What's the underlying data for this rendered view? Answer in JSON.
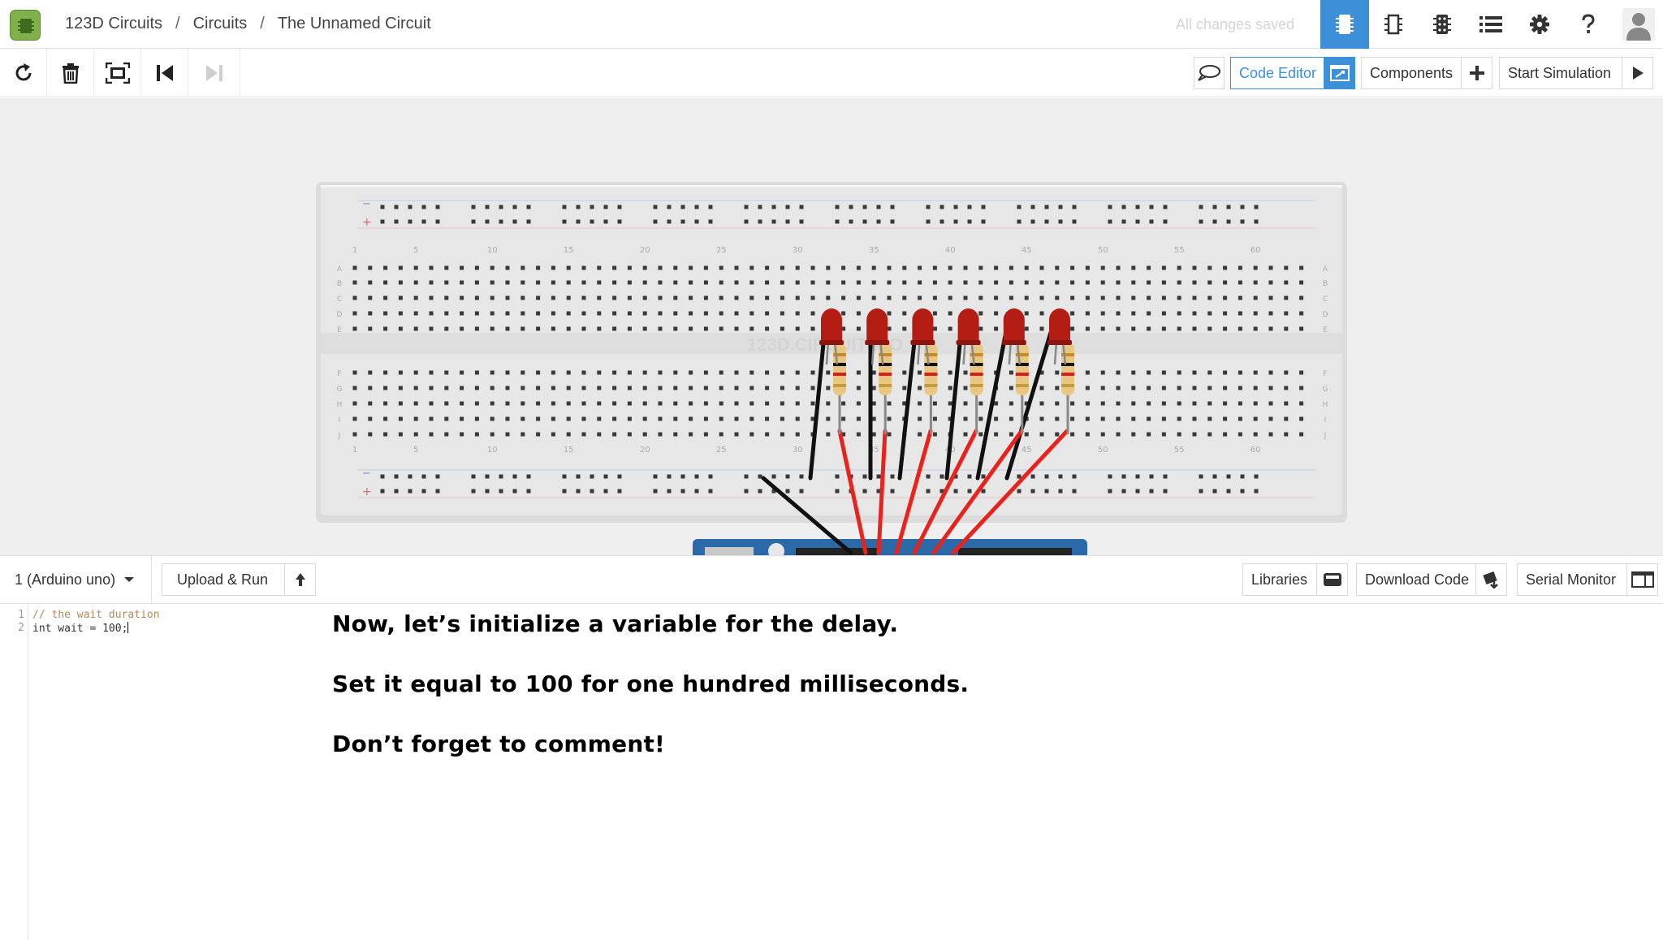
{
  "app": {
    "breadcrumb": [
      "123D Circuits",
      "Circuits",
      "The Unnamed Circuit"
    ],
    "save_status": "All changes saved"
  },
  "topbar_icons": [
    "breadboard-view-icon",
    "schematic-view-icon",
    "pcb-view-icon",
    "component-list-icon",
    "settings-icon",
    "help-icon",
    "user-avatar-icon"
  ],
  "toolbar": {
    "tools": [
      "rotate-icon",
      "delete-icon",
      "fit-to-screen-icon",
      "step-back-icon",
      "step-forward-icon"
    ],
    "code_editor_label": "Code Editor",
    "components_label": "Components",
    "start_simulation_label": "Start Simulation"
  },
  "breadboard": {
    "watermark": "123D.CIRCUITS.IO",
    "column_numbers_top": [
      "1",
      "5",
      "10",
      "15",
      "20",
      "25",
      "30",
      "35",
      "40",
      "45",
      "50",
      "55",
      "60"
    ],
    "column_numbers_bottom": [
      "1",
      "5",
      "10",
      "15",
      "20",
      "25",
      "30",
      "35",
      "40",
      "45",
      "50",
      "55",
      "60"
    ],
    "row_letters_upper": [
      "A",
      "B",
      "C",
      "D",
      "E"
    ],
    "row_letters_lower": [
      "F",
      "G",
      "H",
      "I",
      "J"
    ],
    "rail_minus": "−",
    "rail_plus": "+",
    "led_count": 6,
    "resistor_count": 6,
    "led_color": "#b31d14",
    "wire_colors": [
      "#111111",
      "#e8221c"
    ]
  },
  "code_panel": {
    "board": "1 (Arduino uno)",
    "upload_label": "Upload & Run",
    "libraries_label": "Libraries",
    "download_label": "Download Code",
    "serial_label": "Serial Monitor"
  },
  "code": {
    "line_numbers": [
      "1",
      "2"
    ],
    "lines": [
      "// the wait duration",
      "int wait = 100;"
    ]
  },
  "instructions": [
    "Now, let’s initialize a variable for the delay.",
    "Set it equal to 100 for one hundred milliseconds.",
    "Don’t forget to comment!"
  ]
}
